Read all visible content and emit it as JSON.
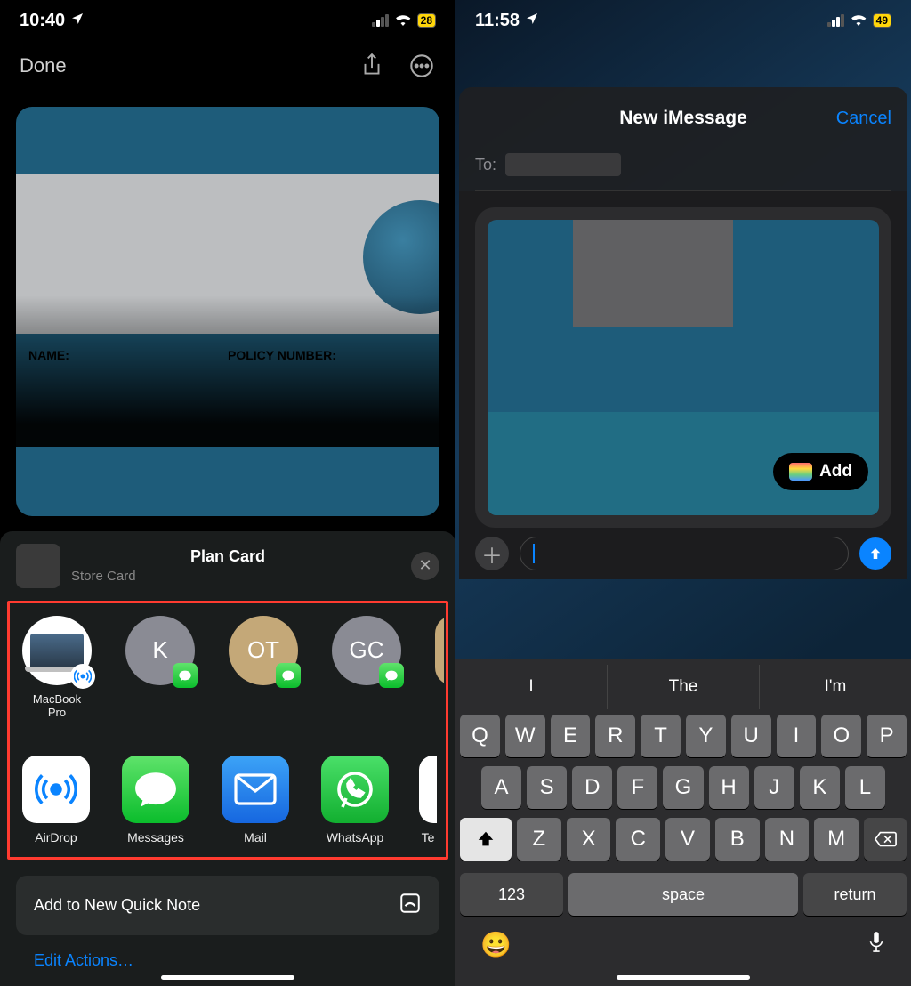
{
  "left": {
    "status": {
      "time": "10:40",
      "battery": "28"
    },
    "nav": {
      "done": "Done"
    },
    "card": {
      "name_label": "NAME:",
      "policy_label": "POLICY NUMBER:"
    },
    "sheet": {
      "title": "Plan Card",
      "subtitle": "Store Card",
      "contacts": [
        {
          "label": "MacBook\nPro",
          "initials": ""
        },
        {
          "label": "",
          "initials": "K"
        },
        {
          "label": "",
          "initials": "OT"
        },
        {
          "label": "",
          "initials": "GC"
        }
      ],
      "apps": [
        {
          "label": "AirDrop"
        },
        {
          "label": "Messages"
        },
        {
          "label": "Mail"
        },
        {
          "label": "WhatsApp"
        },
        {
          "label": "Te"
        }
      ],
      "action": "Add to New Quick Note",
      "edit": "Edit Actions…"
    }
  },
  "right": {
    "status": {
      "time": "11:58",
      "battery": "49"
    },
    "header": {
      "title": "New iMessage",
      "cancel": "Cancel",
      "to": "To:"
    },
    "attachment": {
      "add": "Add"
    },
    "predictions": [
      "I",
      "The",
      "I'm"
    ],
    "keys": {
      "r1": [
        "Q",
        "W",
        "E",
        "R",
        "T",
        "Y",
        "U",
        "I",
        "O",
        "P"
      ],
      "r2": [
        "A",
        "S",
        "D",
        "F",
        "G",
        "H",
        "J",
        "K",
        "L"
      ],
      "r3": [
        "Z",
        "X",
        "C",
        "V",
        "B",
        "N",
        "M"
      ],
      "num": "123",
      "space": "space",
      "return": "return"
    }
  }
}
